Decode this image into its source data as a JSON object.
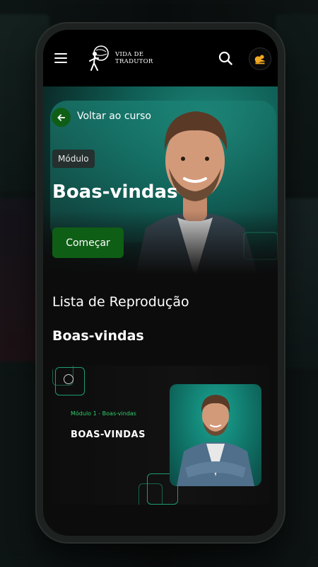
{
  "header": {
    "logo_line1": "VIDA DE",
    "logo_line2": "TRADUTOR"
  },
  "hero": {
    "back_label": "Voltar ao curso",
    "badge": "Módulo",
    "title": "Boas-vindas",
    "start_label": "Começar"
  },
  "playlist": {
    "heading": "Lista de Reprodução",
    "module_title": "Boas-vindas",
    "card": {
      "subtitle": "Módulo 1 - Boas-vindas",
      "title": "BOAS-VINDAS"
    }
  },
  "colors": {
    "accent_green": "#0f5e15",
    "teal": "#1c8476",
    "text_green": "#2fcf6a"
  },
  "icons": [
    "menu-icon",
    "logo-mark-icon",
    "search-icon",
    "user-avatar-icon",
    "arrow-left-icon"
  ]
}
